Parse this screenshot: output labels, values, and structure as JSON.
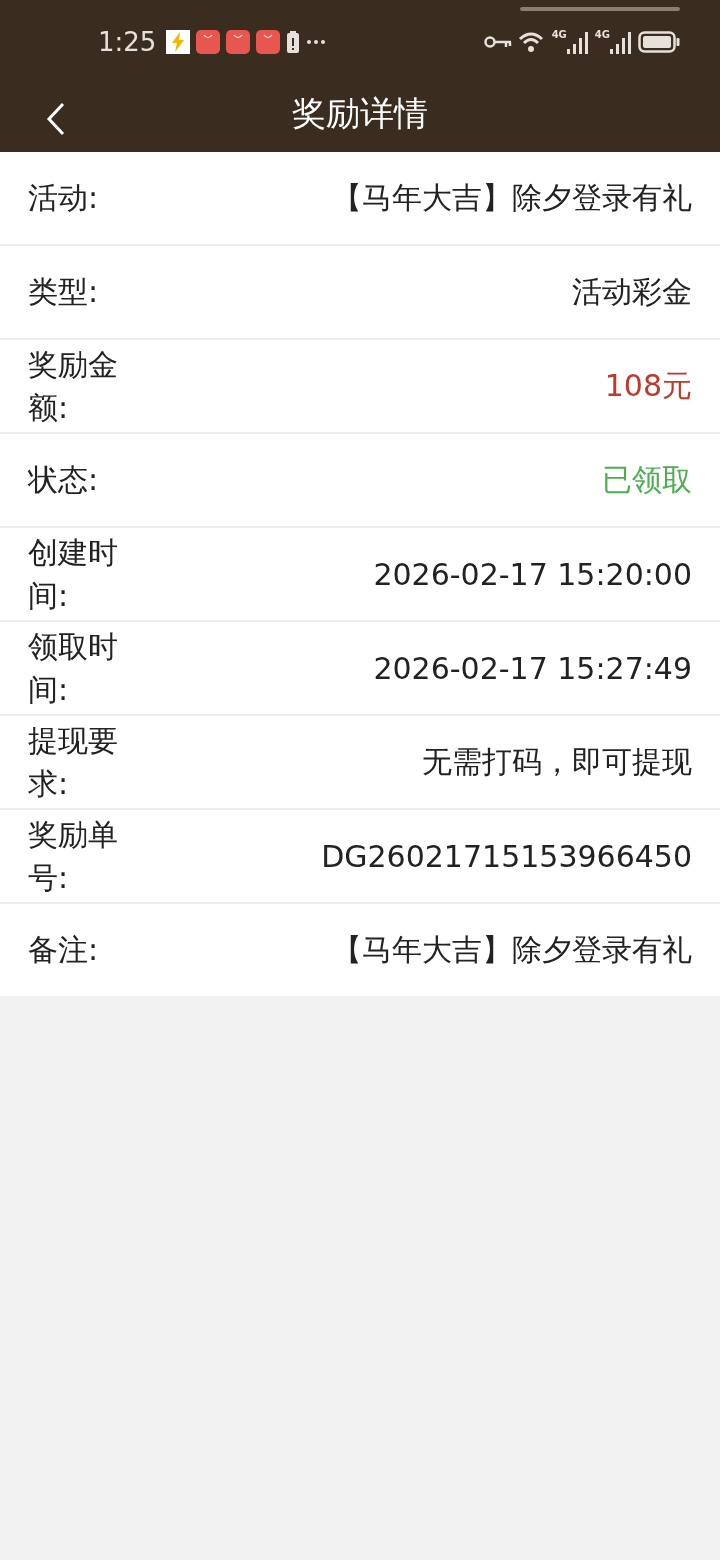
{
  "status_bar": {
    "time": "1:25",
    "network_labels": [
      "4G",
      "4G"
    ]
  },
  "header": {
    "title": "奖励详情"
  },
  "rows": [
    {
      "label": "活动:",
      "value": "【马年大吉】除夕登录有礼",
      "color": "#222222"
    },
    {
      "label": "类型:",
      "value": "活动彩金",
      "color": "#222222"
    },
    {
      "label": "奖励金额:",
      "value": "108元",
      "color": "#c0392b"
    },
    {
      "label": "状态:",
      "value": "已领取",
      "color": "#4caf50"
    },
    {
      "label": "创建时间:",
      "value": "2026-02-17 15:20:00",
      "color": "#222222"
    },
    {
      "label": "领取时间:",
      "value": "2026-02-17 15:27:49",
      "color": "#222222"
    },
    {
      "label": "提现要求:",
      "value": "无需打码，即可提现",
      "color": "#222222"
    },
    {
      "label": "奖励单号:",
      "value": "DG26021715153966450",
      "color": "#222222"
    },
    {
      "label": "备注:",
      "value": "【马年大吉】除夕登录有礼",
      "color": "#222222"
    }
  ]
}
